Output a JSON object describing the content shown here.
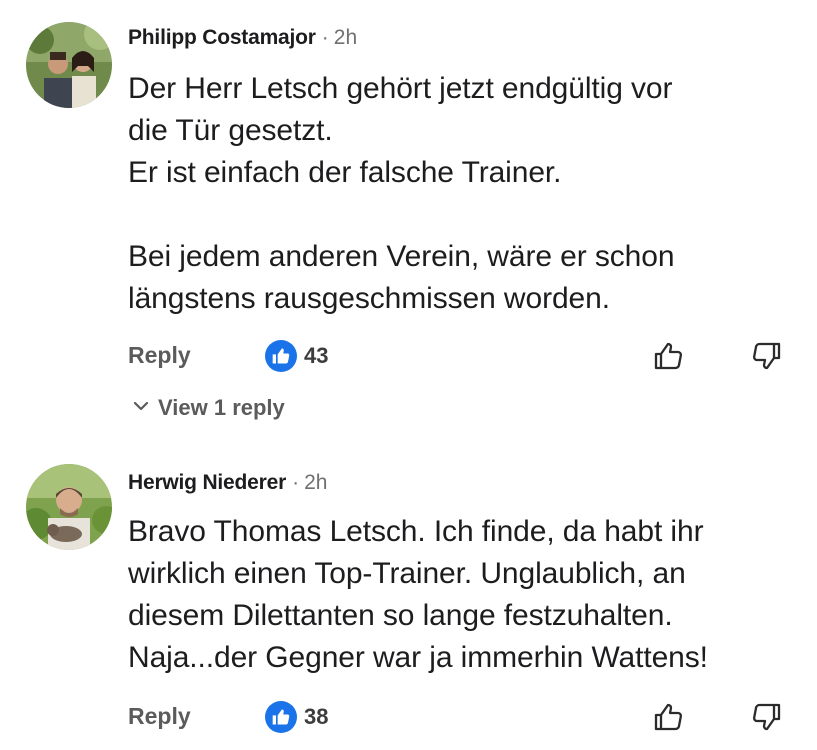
{
  "comments": [
    {
      "author": "Philipp Costamajor",
      "time": "2h",
      "lines": [
        "Der Herr Letsch gehört jetzt endgültig vor",
        "die Tür gesetzt.",
        "Er ist einfach der falsche Trainer.",
        "Bei jedem anderen Verein, wäre er schon",
        "längstens rausgeschmissen worden."
      ],
      "reply_label": "Reply",
      "like_count": "43",
      "view_replies_label": "View 1 reply"
    },
    {
      "author": "Herwig Niederer",
      "time": "2h",
      "lines": [
        "Bravo Thomas Letsch. Ich finde, da habt ihr",
        "wirklich einen Top-Trainer. Unglaublich, an",
        "diesem Dilettanten so lange festzuhalten.",
        "Naja...der Gegner war ja immerhin Wattens!"
      ],
      "reply_label": "Reply",
      "like_count": "38"
    }
  ],
  "separator": "·",
  "icons": {
    "like_badge": "thumbs-up-filled-icon",
    "vote_up": "thumbs-up-outline-icon",
    "vote_down": "thumbs-down-outline-icon",
    "expand": "chevron-down-icon"
  },
  "colors": {
    "accent": "#1a73e8",
    "meta": "#707070",
    "action": "#5b5b5b"
  }
}
